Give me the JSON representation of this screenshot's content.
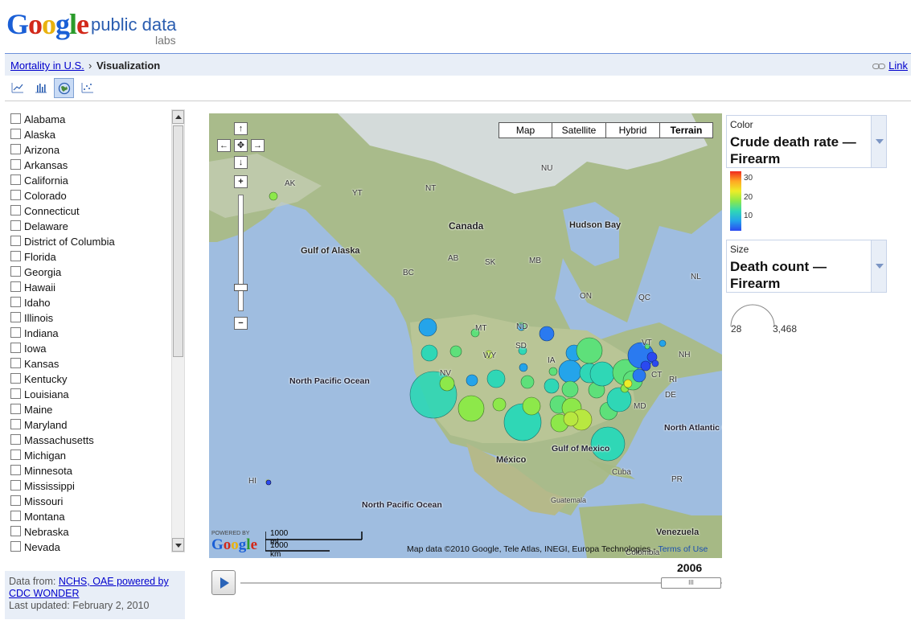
{
  "header": {
    "logo_text": "Google",
    "product": "public data",
    "labs": "labs"
  },
  "breadcrumb": {
    "parent": "Mortality in U.S.",
    "separator": "›",
    "current": "Visualization",
    "link_label": "Link"
  },
  "views": [
    "line-chart-icon",
    "bar-chart-icon",
    "globe-map-icon",
    "scatter-chart-icon"
  ],
  "states": [
    "Alabama",
    "Alaska",
    "Arizona",
    "Arkansas",
    "California",
    "Colorado",
    "Connecticut",
    "Delaware",
    "District of Columbia",
    "Florida",
    "Georgia",
    "Hawaii",
    "Idaho",
    "Illinois",
    "Indiana",
    "Iowa",
    "Kansas",
    "Kentucky",
    "Louisiana",
    "Maine",
    "Maryland",
    "Massachusetts",
    "Michigan",
    "Minnesota",
    "Mississippi",
    "Missouri",
    "Montana",
    "Nebraska",
    "Nevada"
  ],
  "source": {
    "prefix": "Data from:",
    "link": "NCHS, OAE powered by CDC WONDER",
    "updated": "Last updated: February 2, 2010"
  },
  "map": {
    "types": [
      "Map",
      "Satellite",
      "Hybrid",
      "Terrain"
    ],
    "active_type": "Terrain",
    "nav": {
      "up": "↑",
      "left": "←",
      "center": "✥",
      "right": "→",
      "down": "↓",
      "zoom_in": "+",
      "zoom_out": "−"
    },
    "labels": {
      "canada": "Canada",
      "hudson_bay": "Hudson Bay",
      "gulf_alaska": "Gulf of Alaska",
      "north_pacific_1": "North Pacific Ocean",
      "north_pacific_2": "North Pacific Ocean",
      "north_atlantic": "North Atlantic Ocean",
      "gulf_mexico": "Gulf of Mexico",
      "mexico": "México",
      "venezuela": "Venezuela",
      "colombia": "Colombia",
      "cuba": "Cuba",
      "guatemala": "Guatemala",
      "pr": "PR",
      "ak": "AK",
      "yt": "YT",
      "nt": "NT",
      "nu": "NU",
      "bc": "BC",
      "ab": "AB",
      "sk": "SK",
      "mb": "MB",
      "on": "ON",
      "qc": "QC",
      "nl": "NL",
      "mt": "MT",
      "nd": "ND",
      "sd": "SD",
      "wy": "WY",
      "nv": "NV",
      "ia": "IA",
      "vt": "VT",
      "nh": "NH",
      "ri": "RI",
      "ct": "CT",
      "de": "DE",
      "md": "MD",
      "hi": "HI"
    },
    "scale_mi": "1000 mi",
    "scale_km": "1000 km",
    "powered_by": "POWERED BY",
    "powered_logo": "Google",
    "attribution": "Map data ©2010  Google, Tele Atlas, INEGI, Europa Technologies - ",
    "terms": "Terms of Use"
  },
  "legend": {
    "color_label": "Color",
    "color_metric": "Crude death rate — Firearm",
    "color_ticks": [
      "30",
      "20",
      "10"
    ],
    "size_label": "Size",
    "size_metric": "Death count — Firearm",
    "size_min": "28",
    "size_max": "3,468"
  },
  "timeline": {
    "year": "2006",
    "handle_grip": "III"
  },
  "colors": {
    "accent_blue": "#2a5db0",
    "crumb_bg": "#e8eef7",
    "link": "#0000cc"
  }
}
